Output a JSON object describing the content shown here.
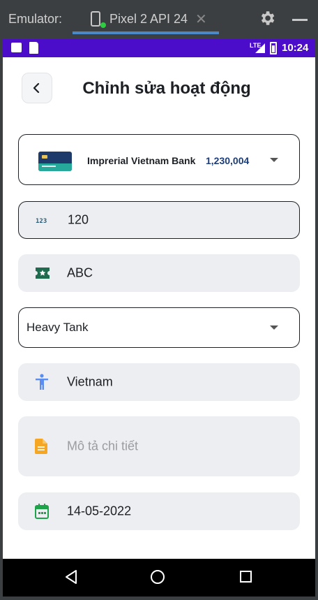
{
  "emulator": {
    "label": "Emulator:",
    "device_tab": "Pixel 2 API 24",
    "close_glyph": "✕"
  },
  "status_bar": {
    "network": "LTE",
    "time": "10:24"
  },
  "header": {
    "title": "Chỉnh sửa hoạt động"
  },
  "form": {
    "account": {
      "bank_name": "Imprerial Vietnam Bank",
      "balance": "1,230,004"
    },
    "amount": {
      "icon": "numeric-123-icon",
      "value": "120"
    },
    "name": {
      "icon": "ticket-star-icon",
      "value": "ABC"
    },
    "category": {
      "value": "Heavy Tank"
    },
    "location": {
      "icon": "person-accessibility-icon",
      "value": "Vietnam"
    },
    "description": {
      "icon": "document-icon",
      "placeholder": "Mô tả chi tiết"
    },
    "date": {
      "icon": "calendar-icon",
      "value": "14-05-2022"
    }
  },
  "colors": {
    "status_bar": "#4b0dc9",
    "field_bg": "#eceef1",
    "balance_text": "#1c3d7a",
    "ticket_icon": "#1f6b4f",
    "person_icon": "#5b8def",
    "doc_icon": "#f5a623",
    "calendar_icon": "#1fa34a"
  }
}
